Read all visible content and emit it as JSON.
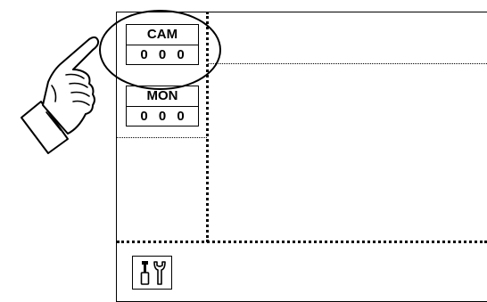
{
  "cam": {
    "label": "CAM",
    "value": "0 0 0"
  },
  "mon": {
    "label": "MON",
    "value": "0 0 0"
  },
  "icons": [
    "pointing-hand-icon",
    "tools-icon"
  ]
}
